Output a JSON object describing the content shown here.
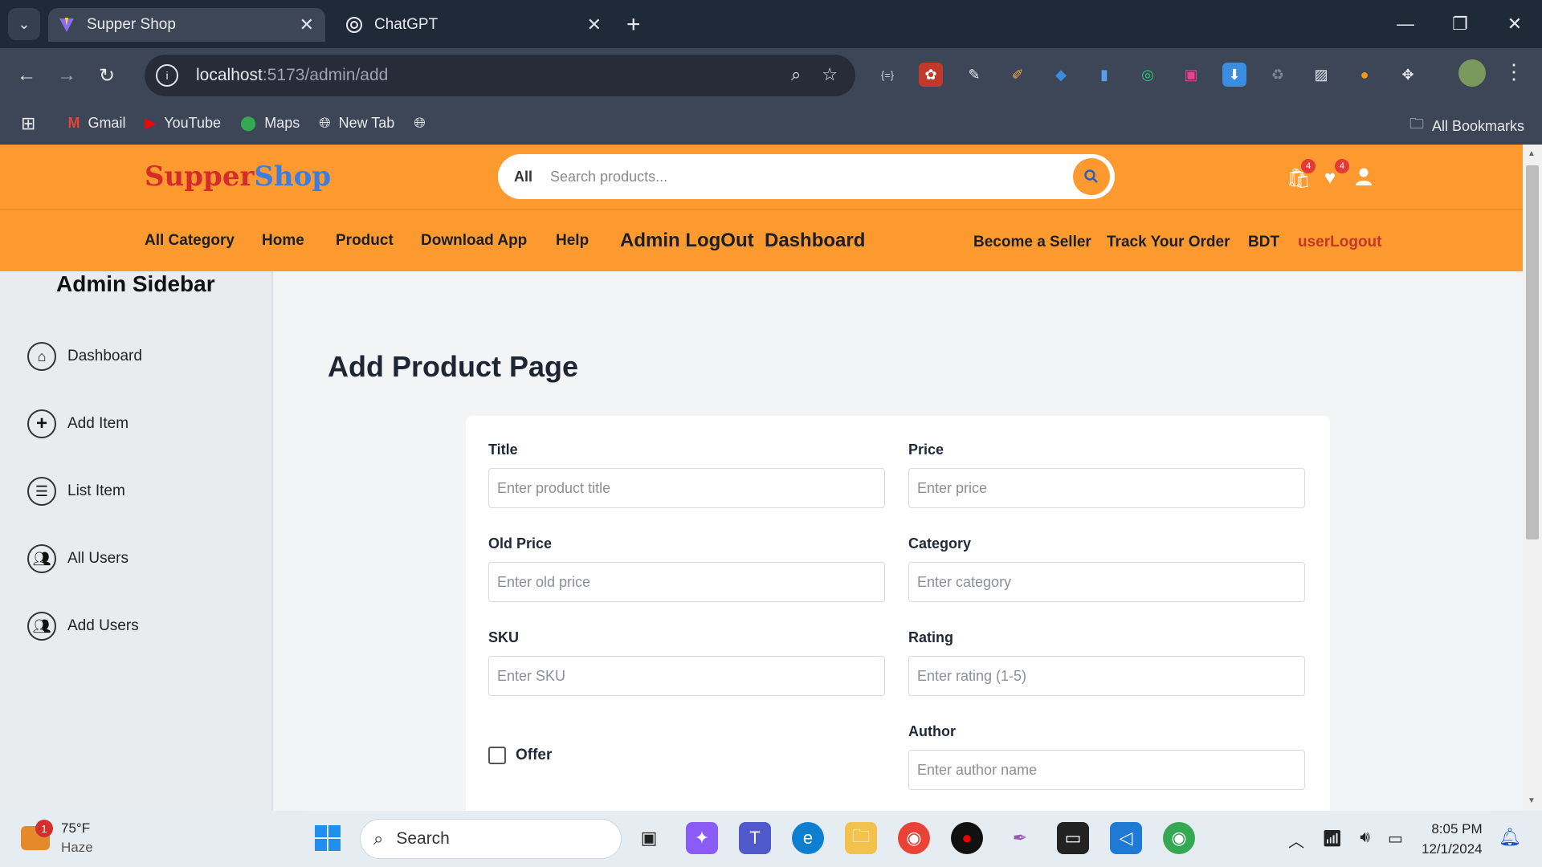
{
  "browser": {
    "tabs": [
      {
        "title": "Supper Shop"
      },
      {
        "title": "ChatGPT"
      }
    ],
    "new_tab": "+",
    "url_host": "localhost",
    "url_path": ":5173/admin/add",
    "bookmarks": [
      "Gmail",
      "YouTube",
      "Maps",
      "New Tab"
    ],
    "all_bookmarks": "All Bookmarks"
  },
  "site": {
    "logo_a": "Supper",
    "logo_b": "Shop",
    "search_scope": "All",
    "search_placeholder": "Search products...",
    "cart_count": "4",
    "wishlist_count": "4",
    "menu": [
      "All Category",
      "Home",
      "Product",
      "Download App",
      "Help",
      "Admin LogOut",
      "Dashboard",
      "Become a Seller",
      "Track Your Order",
      "BDT",
      "userLogout"
    ]
  },
  "sidebar": {
    "title": "Admin Sidebar",
    "items": [
      {
        "label": "Dashboard"
      },
      {
        "label": "Add Item"
      },
      {
        "label": "List Item"
      },
      {
        "label": "All Users"
      },
      {
        "label": "Add Users"
      }
    ]
  },
  "form": {
    "page_title": "Add Product Page",
    "fields": [
      {
        "label": "Title",
        "placeholder": "Enter product title"
      },
      {
        "label": "Price",
        "placeholder": "Enter price"
      },
      {
        "label": "Old Price",
        "placeholder": "Enter old price"
      },
      {
        "label": "Category",
        "placeholder": "Enter category"
      },
      {
        "label": "SKU",
        "placeholder": "Enter SKU"
      },
      {
        "label": "Rating",
        "placeholder": "Enter rating (1-5)"
      },
      {
        "label": "Author",
        "placeholder": "Enter author name"
      }
    ],
    "offer_label": "Offer"
  },
  "taskbar": {
    "weather_temp": "75°F",
    "weather_desc": "Haze",
    "weather_badge": "1",
    "search_label": "Search",
    "time": "8:05 PM",
    "date": "12/1/2024"
  },
  "colors": {
    "brand_orange": "#fd9a2f",
    "logo_red": "#d62b2b",
    "logo_blue": "#3b7de0",
    "logout_red": "#c0392b"
  }
}
